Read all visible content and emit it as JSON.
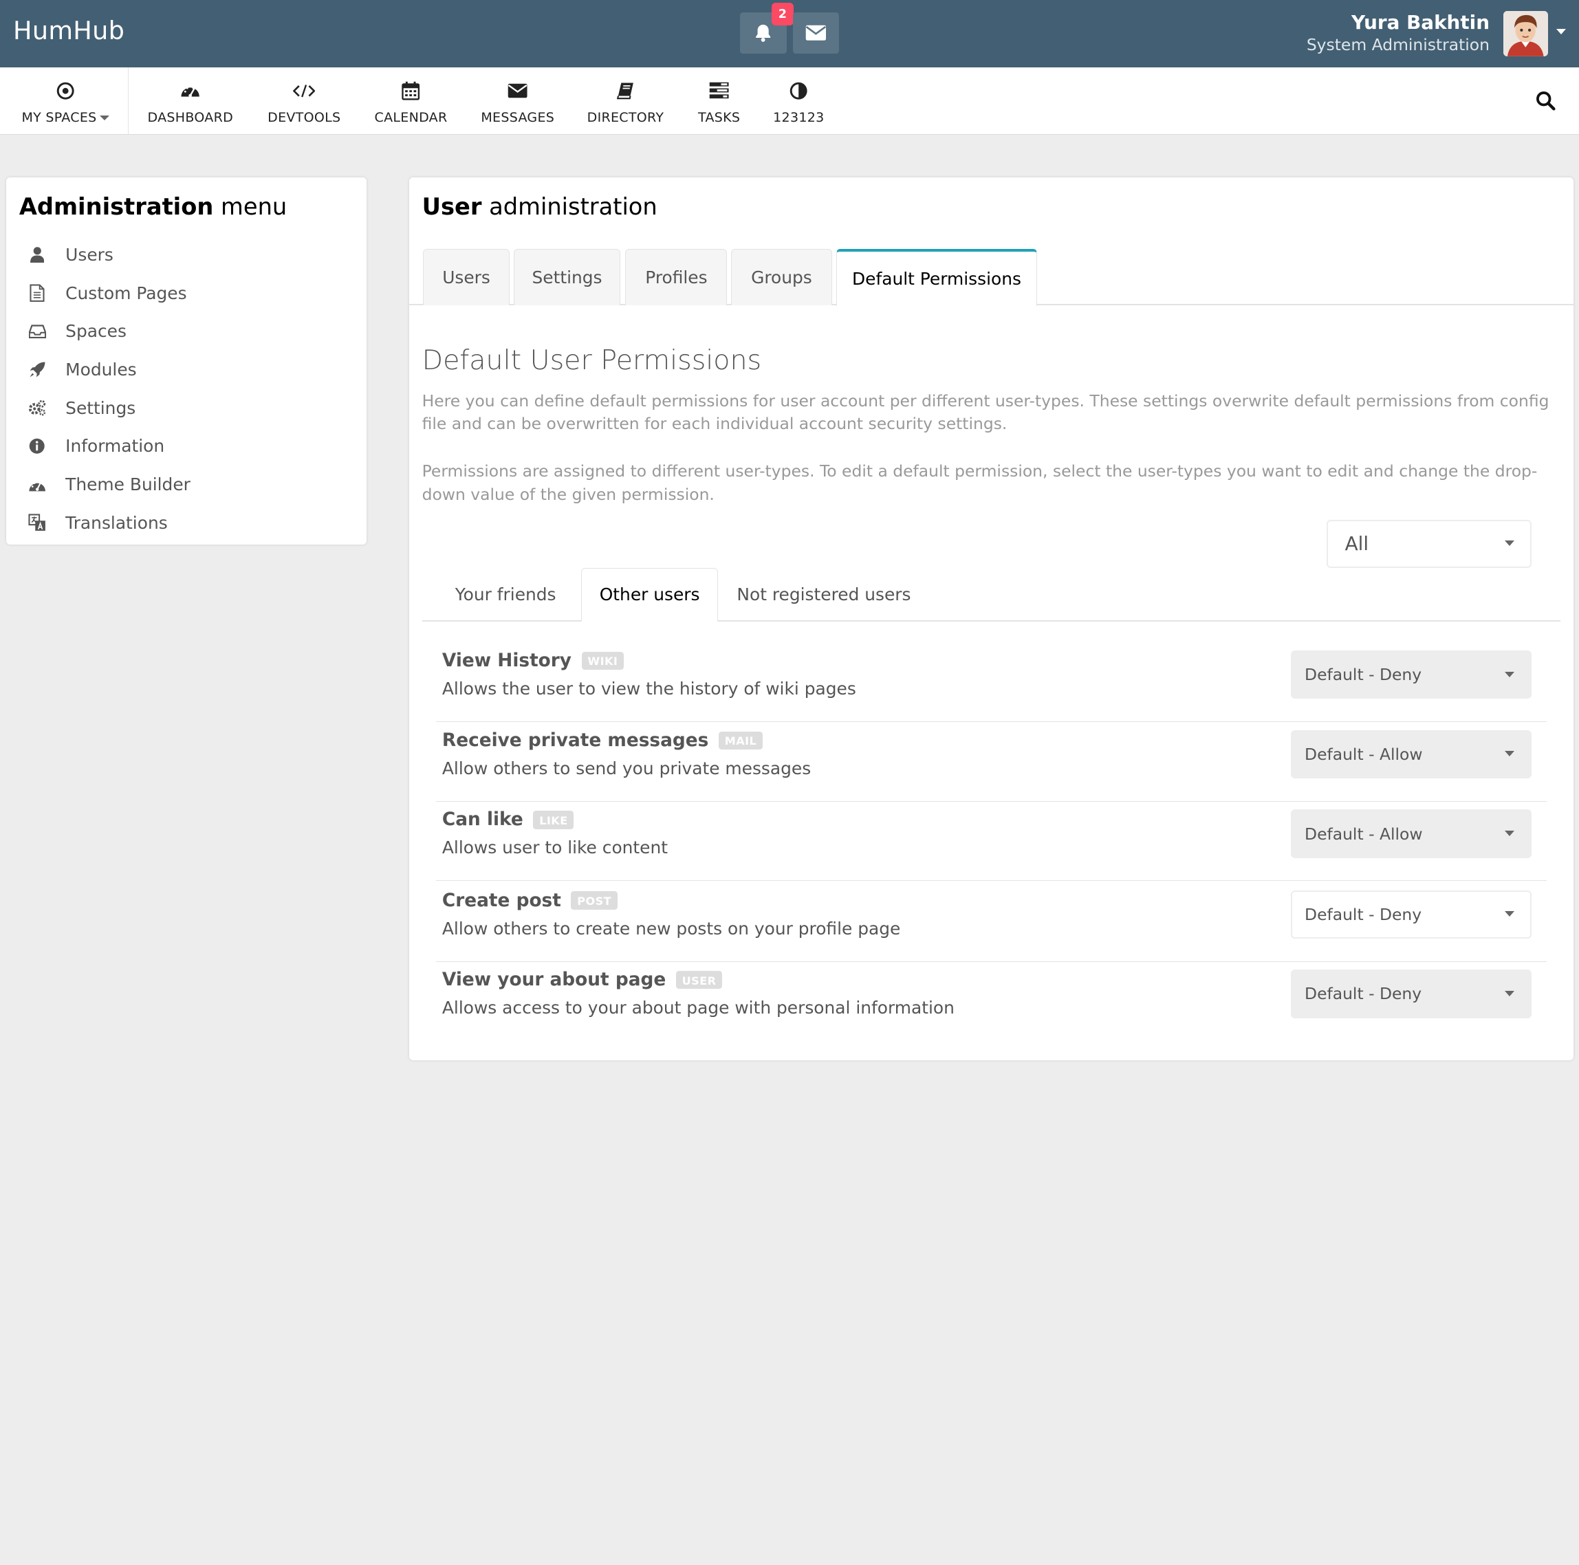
{
  "topbar": {
    "brand": "HumHub",
    "notifications_count": "2",
    "user_name": "Yura Bakhtin",
    "user_role": "System Administration",
    "colors": {
      "bar": "#435f73",
      "badge": "#fc4a64",
      "accent": "#21a1b3"
    }
  },
  "nav": {
    "items": [
      {
        "label": "MY SPACES",
        "icon": "target-icon"
      },
      {
        "label": "DASHBOARD",
        "icon": "dashboard-icon"
      },
      {
        "label": "DEVTOOLS",
        "icon": "code-icon"
      },
      {
        "label": "CALENDAR",
        "icon": "calendar-icon"
      },
      {
        "label": "MESSAGES",
        "icon": "envelope-icon"
      },
      {
        "label": "DIRECTORY",
        "icon": "book-icon"
      },
      {
        "label": "TASKS",
        "icon": "tasks-icon"
      },
      {
        "label": "123123",
        "icon": "contrast-icon"
      }
    ]
  },
  "admin_menu": {
    "title_bold": "Administration",
    "title_rest": "menu",
    "items": [
      {
        "label": "Users",
        "icon": "user-icon"
      },
      {
        "label": "Custom Pages",
        "icon": "file-icon"
      },
      {
        "label": "Spaces",
        "icon": "inbox-icon"
      },
      {
        "label": "Modules",
        "icon": "rocket-icon"
      },
      {
        "label": "Settings",
        "icon": "gears-icon"
      },
      {
        "label": "Information",
        "icon": "info-icon"
      },
      {
        "label": "Theme Builder",
        "icon": "palette-icon"
      },
      {
        "label": "Translations",
        "icon": "translate-icon"
      }
    ]
  },
  "main": {
    "title_bold": "User",
    "title_rest": "administration",
    "tabs": [
      "Users",
      "Settings",
      "Profiles",
      "Groups",
      "Default Permissions"
    ],
    "active_tab": "Default Permissions",
    "heading": "Default User Permissions",
    "para1": "Here you can define default permissions for user account per different user-types. These settings overwrite default permissions from config file and can be overwritten for each individual account security settings.",
    "para2": "Permissions are assigned to different user-types. To edit a default permission, select the user-types you want to edit and change the drop-down value of the given permission.",
    "module_filter": "All",
    "subtabs": [
      "Your friends",
      "Other users",
      "Not registered users"
    ],
    "active_subtab": "Other users",
    "permissions": [
      {
        "title": "View History",
        "tag": "WIKI",
        "desc": "Allows the user to view the history of wiki pages",
        "value": "Default - Deny"
      },
      {
        "title": "Receive private messages",
        "tag": "MAIL",
        "desc": "Allow others to send you private messages",
        "value": "Default - Allow"
      },
      {
        "title": "Can like",
        "tag": "LIKE",
        "desc": "Allows user to like content",
        "value": "Default - Allow"
      },
      {
        "title": "Create post",
        "tag": "POST",
        "desc": "Allow others to create new posts on your profile page",
        "value": "Default - Deny"
      },
      {
        "title": "View your about page",
        "tag": "USER",
        "desc": "Allows access to your about page with personal information",
        "value": "Default - Deny"
      }
    ]
  }
}
